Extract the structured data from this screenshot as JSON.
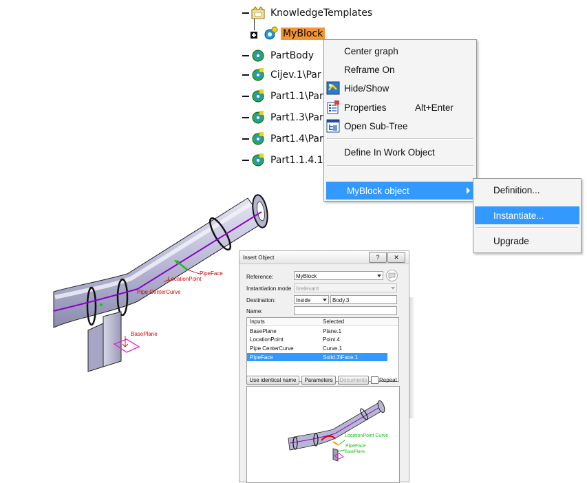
{
  "tree": {
    "items": [
      {
        "label": "KnowledgeTemplates",
        "icon": "knowledge-templates-icon"
      },
      {
        "label": "MyBlock",
        "icon": "myblock-gear-icon",
        "selected": true
      },
      {
        "label": "PartBody",
        "icon": "gear-icon"
      },
      {
        "label": "Cijev.1\\Par",
        "icon": "gear-icon"
      },
      {
        "label": "Part1.1\\Par",
        "icon": "gear-icon"
      },
      {
        "label": "Part1.3\\Par",
        "icon": "gear-icon"
      },
      {
        "label": "Part1.4\\Par",
        "icon": "gear-icon"
      },
      {
        "label": "Part1.1.4.1\\",
        "icon": "gear-icon"
      }
    ]
  },
  "context_menu": {
    "items": [
      {
        "label": "Center graph"
      },
      {
        "label": "Reframe On"
      },
      {
        "label": "Hide/Show",
        "icon": "hide-show-icon"
      },
      {
        "label": "Properties",
        "shortcut": "Alt+Enter",
        "icon": "properties-icon"
      },
      {
        "label": "Open Sub-Tree",
        "icon": "subtree-icon"
      },
      {
        "label": "Define In Work Object"
      }
    ],
    "submenu_trigger": "MyBlock object"
  },
  "submenu": {
    "items": [
      {
        "label": "Definition..."
      },
      {
        "label": "Instantiate...",
        "highlighted": true
      },
      {
        "label": "Upgrade"
      }
    ]
  },
  "viewport_labels": {
    "pipe_face": "PipeFace",
    "location_point": "LocationPoint",
    "pipe_center_curve": "Pipe CenterCurve",
    "base_plane": "BasePlane"
  },
  "dialog": {
    "title": "Insert Object",
    "reference_label": "Reference:",
    "reference_value": "MyBlock",
    "instantiation_label": "Instantiation mode",
    "instantiation_value": "Irrelevant",
    "destination_label": "Destination:",
    "destination_mode": "Inside",
    "destination_value": "Body.3",
    "name_label": "Name:",
    "name_value": "",
    "table_headers": [
      "Inputs",
      "Selected"
    ],
    "table_rows": [
      {
        "input": "BasePlane",
        "selected": "Plane.1"
      },
      {
        "input": "LocationPoint",
        "selected": "Point.4"
      },
      {
        "input": "Pipe CenterCurve",
        "selected": "Curve.1"
      },
      {
        "input": "PipeFace",
        "selected": "Solid.3\\Face.1",
        "highlighted": true
      }
    ],
    "buttons": {
      "use_identical": "Use identical name",
      "parameters": "Parameters",
      "documents": "Documents",
      "repeat": "Repeat"
    },
    "preview_labels": {
      "curve": "LocationPoint Curve",
      "pipe_face": "PipeFace",
      "base_plane": "BasePlane"
    }
  },
  "colors": {
    "selection_orange": "#f59434",
    "menu_highlight": "#3399ff",
    "curve_purple": "#8e00c8",
    "label_red": "#d40000"
  }
}
